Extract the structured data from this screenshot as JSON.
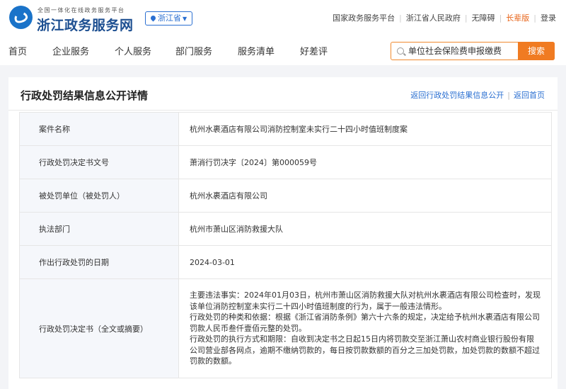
{
  "header": {
    "brand_sub": "全国一体化在线政务服务平台",
    "brand_main": "浙江政务服务网",
    "region": "浙江省",
    "top_links": [
      {
        "label": "国家政务服务平台"
      },
      {
        "label": "浙江省人民政府"
      },
      {
        "label": "无障碍"
      },
      {
        "label": "长辈版"
      },
      {
        "label": "登录"
      }
    ],
    "nav": [
      "首页",
      "企业服务",
      "个人服务",
      "部门服务",
      "服务清单",
      "好差评"
    ],
    "search": {
      "placeholder": "单位社会保险费申报缴费",
      "button": "搜索"
    }
  },
  "page": {
    "title": "行政处罚结果信息公开详情",
    "back_list": "返回行政处罚结果信息公开",
    "back_home": "返回首页"
  },
  "details": [
    {
      "label": "案件名称",
      "value": "杭州水裹酒店有限公司消防控制室未实行二十四小时值班制度案"
    },
    {
      "label": "行政处罚决定书文号",
      "value": "萧消行罚决字〔2024〕第000059号"
    },
    {
      "label": "被处罚单位（被处罚人）",
      "value": "杭州水裹酒店有限公司"
    },
    {
      "label": "执法部门",
      "value": "杭州市萧山区消防救援大队"
    },
    {
      "label": "作出行政处罚的日期",
      "value": "2024-03-01"
    },
    {
      "label": "行政处罚决定书（全文或摘要）",
      "paragraphs": [
        "主要违法事实：2024年01月03日，杭州市萧山区消防救援大队对杭州水裹酒店有限公司检查时，发现该单位消防控制室未实行二十四小时值班制度的行为，属于一般违法情形。",
        "行政处罚的种类和依据：根据《浙江省消防条例》第六十六条的规定，决定给予杭州水裹酒店有限公司罚款人民币叁仟壹佰元整的处罚。",
        "行政处罚的执行方式和期限：自收到决定书之日起15日内将罚款交至浙江萧山农村商业银行股份有限公司营业部各网点，逾期不缴纳罚款的，每日按罚款数额的百分之三加处罚款，加处罚款的数额不超过罚款的数额。"
      ]
    }
  ]
}
